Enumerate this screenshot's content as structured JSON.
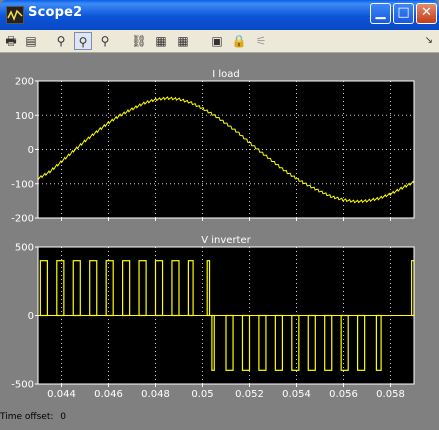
{
  "window": {
    "title": "Scope2",
    "buttons": [
      "minimize",
      "maximize",
      "close"
    ]
  },
  "toolbar": {
    "items": [
      {
        "name": "print-icon",
        "glyph": "🖶",
        "pressed": false,
        "enabled": true
      },
      {
        "name": "parameters-icon",
        "glyph": "▤",
        "pressed": false,
        "enabled": true
      },
      {
        "name": "zoom-icon",
        "glyph": "⚲",
        "pressed": false,
        "enabled": true
      },
      {
        "name": "zoom-x-icon",
        "glyph": "⚲",
        "pressed": true,
        "enabled": true
      },
      {
        "name": "zoom-y-icon",
        "glyph": "⚲",
        "pressed": false,
        "enabled": true
      },
      {
        "name": "autoscale-icon",
        "glyph": "⛓",
        "pressed": false,
        "enabled": true
      },
      {
        "name": "save-axes-icon",
        "glyph": "▦",
        "pressed": false,
        "enabled": true
      },
      {
        "name": "restore-axes-icon",
        "glyph": "▦",
        "pressed": false,
        "enabled": true
      },
      {
        "name": "floating-scope-icon",
        "glyph": "▣",
        "pressed": false,
        "enabled": true
      },
      {
        "name": "lock-icon",
        "glyph": "🔒",
        "pressed": false,
        "enabled": false
      },
      {
        "name": "signal-selection-icon",
        "glyph": "⚟",
        "pressed": false,
        "enabled": false
      }
    ]
  },
  "footer": {
    "label": "Time offset:",
    "value": "0"
  },
  "colors": {
    "trace": "#ffff00",
    "axes_bg": "#000000",
    "grid": "#cccccc",
    "text": "#ffffff",
    "frame": "#808080"
  },
  "chart_data": [
    {
      "type": "line",
      "title": "I load",
      "xlim": [
        0.043,
        0.059
      ],
      "ylim": [
        -200,
        200
      ],
      "yticks": [
        -200,
        -100,
        0,
        100,
        200
      ],
      "xticks": [
        0.044,
        0.046,
        0.048,
        0.05,
        0.052,
        0.054,
        0.056,
        0.058
      ],
      "show_xticklabels": false,
      "grid": true,
      "series": [
        {
          "x": [
            0.043,
            0.0435,
            0.044,
            0.0445,
            0.045,
            0.0455,
            0.046,
            0.0465,
            0.047,
            0.0475,
            0.048,
            0.0485,
            0.049,
            0.0495,
            0.05,
            0.0505,
            0.051,
            0.0515,
            0.052,
            0.0525,
            0.053,
            0.0535,
            0.054,
            0.0545,
            0.055,
            0.0555,
            0.056,
            0.0565,
            0.057,
            0.0575,
            0.058,
            0.0585,
            0.059
          ],
          "y": [
            -85,
            -65,
            -35,
            -5,
            25,
            52,
            78,
            100,
            118,
            135,
            146,
            150,
            147,
            137,
            120,
            100,
            76,
            50,
            20,
            -8,
            -35,
            -62,
            -85,
            -105,
            -122,
            -138,
            -147,
            -152,
            -150,
            -143,
            -130,
            -112,
            -95
          ]
        }
      ]
    },
    {
      "type": "line",
      "title": "V inverter",
      "xlim": [
        0.043,
        0.059
      ],
      "ylim": [
        -500,
        500
      ],
      "yticks": [
        -500,
        0,
        500
      ],
      "xticks": [
        0.044,
        0.046,
        0.048,
        0.05,
        0.052,
        0.054,
        0.056,
        0.058
      ],
      "xticklabels": [
        "0.044",
        "0.046",
        "0.048",
        "0.05",
        "0.052",
        "0.054",
        "0.056",
        "0.058"
      ],
      "grid": true,
      "pwm": {
        "levels": [
          400,
          0,
          -400
        ],
        "pulses": [
          [
            0.0431,
            0.0434,
            400
          ],
          [
            0.0438,
            0.0441,
            400
          ],
          [
            0.0445,
            0.0448,
            400
          ],
          [
            0.0452,
            0.0455,
            400
          ],
          [
            0.0459,
            0.0462,
            400
          ],
          [
            0.0466,
            0.0469,
            400
          ],
          [
            0.0473,
            0.0476,
            400
          ],
          [
            0.048,
            0.0483,
            400
          ],
          [
            0.0487,
            0.049,
            400
          ],
          [
            0.0494,
            0.0496,
            400
          ],
          [
            0.0502,
            0.0503,
            400
          ],
          [
            0.0504,
            0.0505,
            -400
          ],
          [
            0.051,
            0.0513,
            -400
          ],
          [
            0.0517,
            0.052,
            -400
          ],
          [
            0.0524,
            0.0527,
            -400
          ],
          [
            0.0531,
            0.0534,
            -400
          ],
          [
            0.0538,
            0.0541,
            -400
          ],
          [
            0.0545,
            0.0548,
            -400
          ],
          [
            0.0552,
            0.0555,
            -400
          ],
          [
            0.0559,
            0.0562,
            -400
          ],
          [
            0.0566,
            0.0569,
            -400
          ],
          [
            0.0574,
            0.0576,
            -400
          ],
          [
            0.0589,
            0.059,
            400
          ]
        ]
      }
    }
  ]
}
